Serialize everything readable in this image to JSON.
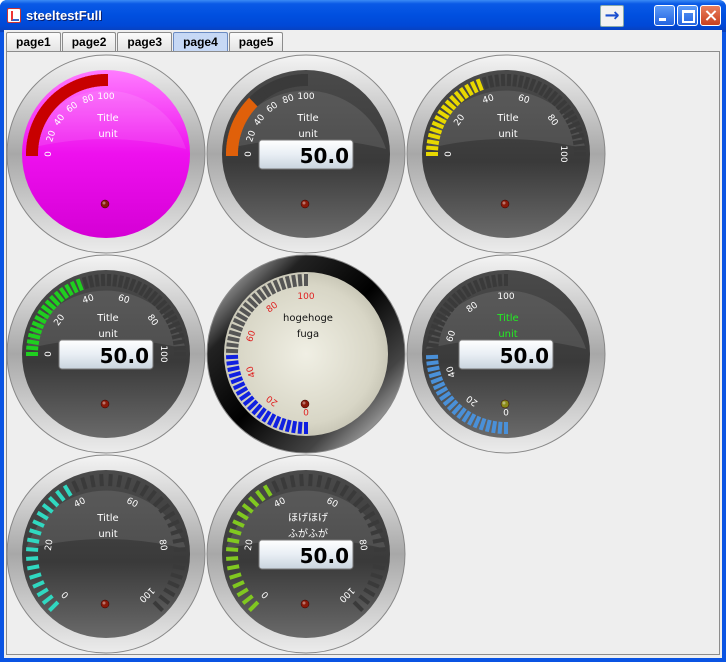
{
  "window": {
    "title": "steeltestFull"
  },
  "tabs": [
    "page1",
    "page2",
    "page3",
    "page4",
    "page5"
  ],
  "active_tab": 3,
  "gauges": [
    {
      "title": "Title",
      "unit": "unit",
      "labels": [
        "0",
        "20",
        "40",
        "60",
        "80",
        "100"
      ],
      "fill": "magenta",
      "lcd": null
    },
    {
      "title": "Title",
      "unit": "unit",
      "labels": [
        "0",
        "20",
        "40",
        "60",
        "80",
        "100"
      ],
      "fill": "dark",
      "lcd": "50.0"
    },
    {
      "title": "Title",
      "unit": "unit",
      "labels": [
        "0",
        "20",
        "40",
        "60",
        "80",
        "100"
      ],
      "fill": "dark",
      "lcd": null
    },
    {
      "title": "Title",
      "unit": "unit",
      "labels": [
        "0",
        "20",
        "40",
        "60",
        "80",
        "100"
      ],
      "fill": "dark",
      "lcd": "50.0"
    },
    {
      "title": "hogehoge",
      "unit": "fuga",
      "labels": [
        "0",
        "20",
        "40",
        "60",
        "80",
        "100"
      ],
      "fill": "beige",
      "lcd": null
    },
    {
      "title": "Title",
      "unit": "unit",
      "labels": [
        "0",
        "20",
        "40",
        "60",
        "80",
        "100"
      ],
      "fill": "dark",
      "lcd": "50.0"
    },
    {
      "title": "Title",
      "unit": "unit",
      "labels": [
        "0",
        "20",
        "40",
        "60",
        "80",
        "100"
      ],
      "fill": "dark",
      "lcd": null
    },
    {
      "title": "ほげほげ",
      "unit": "ふがふが",
      "labels": [
        "0",
        "20",
        "40",
        "60",
        "80",
        "100"
      ],
      "fill": "dark",
      "lcd": "50.0"
    }
  ],
  "colors": {
    "gauge_bar": [
      "#c80000",
      "#e0600a",
      "#e8d800",
      "#1fcf1f",
      "#1020e0",
      "#4a90d8",
      "#30d8c0",
      "#80c820"
    ],
    "title_text": [
      "#ffffff",
      "#ffffff",
      "#ffffff",
      "#ffffff",
      "#111111",
      "#22ee22",
      "#ffffff",
      "#ffffff"
    ],
    "tick_label": [
      "#ffffff",
      "#ffffff",
      "#ffffff",
      "#ffffff",
      "#e02020",
      "#ffffff",
      "#ffffff",
      "#ffffff"
    ]
  }
}
